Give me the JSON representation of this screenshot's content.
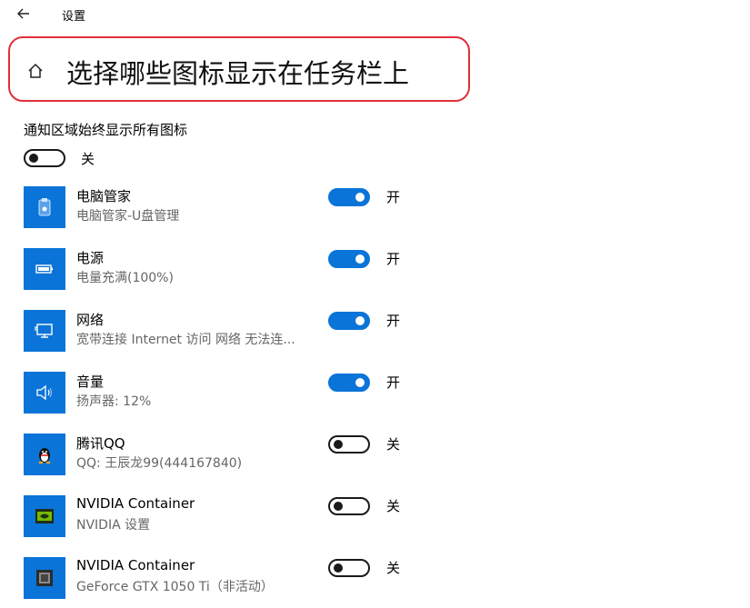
{
  "window": {
    "title": "设置"
  },
  "header": {
    "title": "选择哪些图标显示在任务栏上"
  },
  "master": {
    "label": "通知区域始终显示所有图标",
    "state": "关",
    "on": false
  },
  "items": [
    {
      "name": "电脑管家",
      "sub": "电脑管家-U盘管理",
      "state": "开",
      "on": true,
      "icon": "usb-drive-icon"
    },
    {
      "name": "电源",
      "sub": "电量充满(100%)",
      "state": "开",
      "on": true,
      "icon": "battery-icon"
    },
    {
      "name": "网络",
      "sub": "宽带连接 Internet 访问  网络 无法连...",
      "state": "开",
      "on": true,
      "icon": "network-monitor-icon"
    },
    {
      "name": "音量",
      "sub": "扬声器: 12%",
      "state": "开",
      "on": true,
      "icon": "speaker-icon"
    },
    {
      "name": "腾讯QQ",
      "sub": "QQ: 王辰龙99(444167840)",
      "state": "关",
      "on": false,
      "icon": "qq-penguin-icon"
    },
    {
      "name": "NVIDIA Container",
      "sub": "NVIDIA 设置",
      "state": "关",
      "on": false,
      "icon": "nvidia-icon"
    },
    {
      "name": "NVIDIA Container",
      "sub": "GeForce GTX 1050 Ti（非活动）",
      "state": "关",
      "on": false,
      "icon": "gpu-chip-icon"
    }
  ],
  "colors": {
    "accent": "#0a74d8",
    "highlight_border": "#e0303a"
  }
}
